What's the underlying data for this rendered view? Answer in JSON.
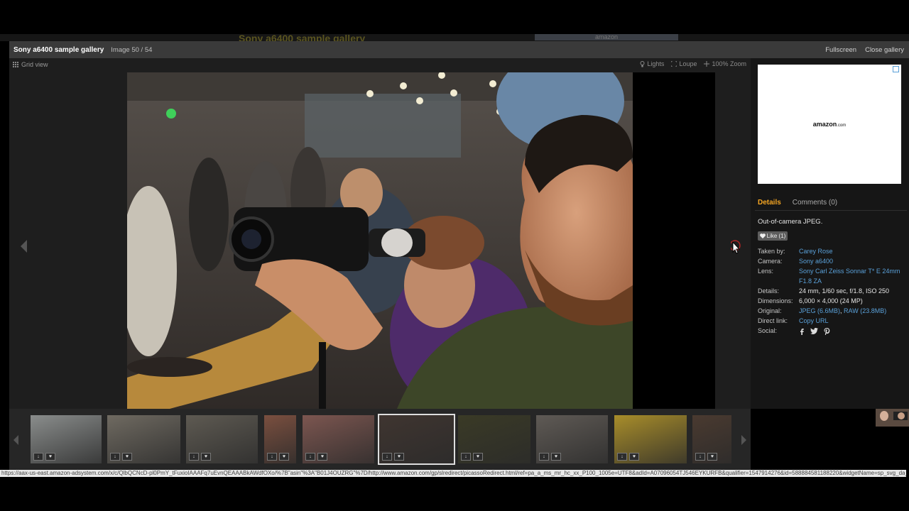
{
  "background_page": {
    "title": "Sony a6400 sample gallery",
    "ad_label": "amazon"
  },
  "header": {
    "gallery_title": "Sony a6400 sample gallery",
    "image_counter": "Image 50 / 54",
    "fullscreen_label": "Fullscreen",
    "close_label": "Close gallery"
  },
  "viewer": {
    "grid_view_label": "Grid view",
    "tools": {
      "lights": "Lights",
      "loupe": "Loupe",
      "zoom": "100% Zoom"
    }
  },
  "sidebar": {
    "ad": {
      "logo": "amazon",
      "logo_suffix": ".com"
    },
    "tabs": {
      "details": "Details",
      "comments": "Comments (0)"
    },
    "description": "Out-of-camera JPEG.",
    "like_button": "Like (1)",
    "meta": {
      "taken_by": {
        "label": "Taken by:",
        "value": "Carey Rose"
      },
      "camera": {
        "label": "Camera:",
        "value": "Sony a6400"
      },
      "lens": {
        "label": "Lens:",
        "value": "Sony Carl Zeiss Sonnar T* E 24mm F1.8 ZA"
      },
      "details": {
        "label": "Details:",
        "value": "24 mm, 1/60 sec, f/1.8, ISO 250"
      },
      "dimensions": {
        "label": "Dimensions:",
        "value": "6,000 × 4,000 (24 MP)"
      },
      "original": {
        "label": "Original:",
        "jpeg": "JPEG (6.6MB)",
        "sep": ", ",
        "raw": "RAW (23.8MB)"
      },
      "direct_link": {
        "label": "Direct link:",
        "value": "Copy URL"
      },
      "social": {
        "label": "Social:"
      }
    }
  },
  "filmstrip": {
    "active_index": 5,
    "thumbnails": [
      {
        "name": "skateboarder-under-bridge",
        "color": "#8a8d8c"
      },
      {
        "name": "bridge-underside",
        "color": "#6f6a61"
      },
      {
        "name": "bridge-sunlight",
        "color": "#5e5a52"
      },
      {
        "name": "woman-portrait-warm",
        "color": "#7a4f3f"
      },
      {
        "name": "woman-with-camera",
        "color": "#7c5650"
      },
      {
        "name": "photographers-crowd",
        "color": "#3f3530"
      },
      {
        "name": "stage-lights",
        "color": "#3a3a26"
      },
      {
        "name": "man-portrait",
        "color": "#5f5a55"
      },
      {
        "name": "man-with-camera-yellow",
        "color": "#a88d2a"
      },
      {
        "name": "man-portrait-dark",
        "color": "#4a3a30"
      }
    ]
  },
  "status_bar": {
    "url": "https://aax-us-east.amazon-adsystem.com/x/c/QlbQCNcD-pl0PmY_tFuxioIAAAFq7uEvnQEAAABkAWdfOXo/%7B\"asin\"%3A\"B01J4OUZRG\"%7D/http://www.amazon.com/gp/slredirect/picassoRedirect.html/ref=pa_a_ms_mr_hc_xx_P100_1005e=UTF8&adId=A07096054TJ546EYKURFB&qualifier=1547914276&id=588884581188220&widgetName=sp_svg_da_rl"
  },
  "colors": {
    "accent": "#f5a623",
    "link": "#5aa0d8",
    "sidebar_bg": "#161616",
    "viewer_bg": "#1e1e1e"
  }
}
